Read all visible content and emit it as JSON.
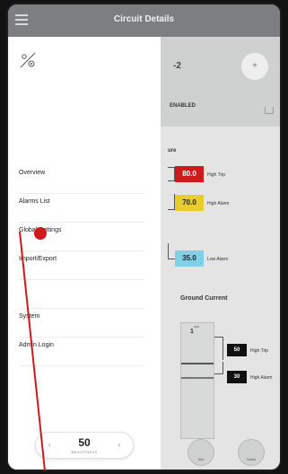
{
  "header": {
    "title": "Circuit Details"
  },
  "background": {
    "circuit_name": "-2",
    "status": "ENABLED",
    "section_label": "ure",
    "high_trip_value": "80.0",
    "high_trip_label": "High Trip",
    "high_alarm_value": "70.0",
    "high_alarm_label": "High Alarm",
    "low_alarm_value": "35.0",
    "low_alarm_label": "Low Alarm",
    "ground_title": "Ground Current",
    "meter_value": "1",
    "meter_unit": "mA",
    "gc_high_trip_value": "50",
    "gc_high_trip_label": "High Trip",
    "gc_high_alarm_value": "30",
    "gc_high_alarm_label": "High Alarm",
    "btn_left_label": "Info",
    "btn_right_label": "Notes"
  },
  "drawer": {
    "items": [
      {
        "label": "Overview"
      },
      {
        "label": "Alarms List"
      },
      {
        "label": "Global Settings"
      },
      {
        "label": "Import/Export"
      },
      {
        "label": ""
      },
      {
        "label": "System"
      },
      {
        "label": "Admin Login"
      }
    ],
    "brightness": {
      "value": "50",
      "label": "BRIGHTNESS"
    }
  },
  "colors": {
    "high_trip": "#d0191a",
    "high_alarm": "#e6cc2c",
    "low_alarm": "#7fd0e8",
    "annotation": "#d0191a"
  }
}
